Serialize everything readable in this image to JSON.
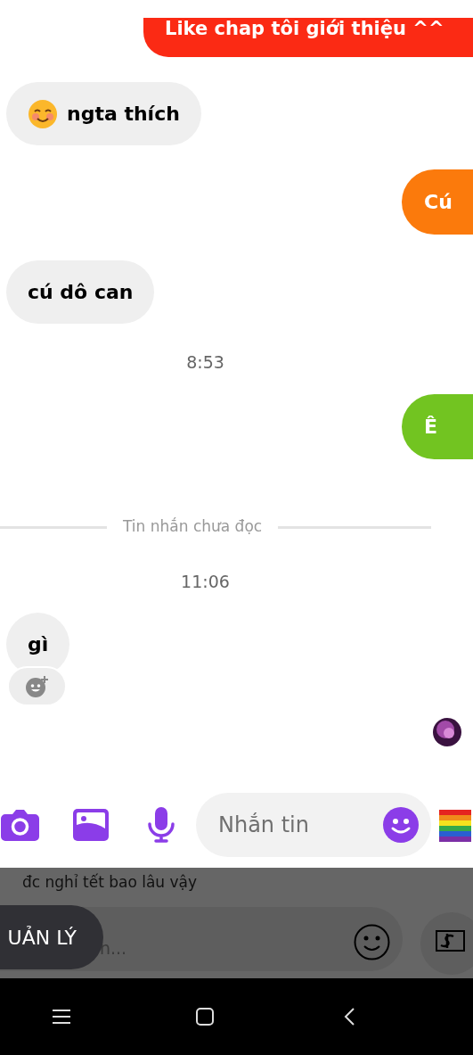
{
  "messages": [
    {
      "kind": "outgoing",
      "text": "Like chap tôi giới thiệu ^^",
      "color": "#fb2a14"
    },
    {
      "kind": "incoming",
      "text": "ngta thích",
      "emoji": true
    },
    {
      "kind": "outgoing",
      "text": "Cú",
      "color": "#fb7a0c"
    },
    {
      "kind": "incoming",
      "text": "cú dô can",
      "emoji": false
    },
    {
      "kind": "time",
      "text": "8:53"
    },
    {
      "kind": "outgoing",
      "text": "Ê",
      "color": "#72c421"
    },
    {
      "kind": "divider",
      "text": "Tin nhắn chưa đọc"
    },
    {
      "kind": "time",
      "text": "11:06"
    },
    {
      "kind": "incoming",
      "text": "gì",
      "emoji": false
    },
    {
      "kind": "reaction"
    },
    {
      "kind": "seen"
    }
  ],
  "composer": {
    "placeholder": "Nhắn tin"
  },
  "overlay": {
    "preview_text": "đc nghỉ tết bao lâu vậy",
    "manage_button": "UẢN LÝ",
    "input_placeholder": "n..."
  }
}
